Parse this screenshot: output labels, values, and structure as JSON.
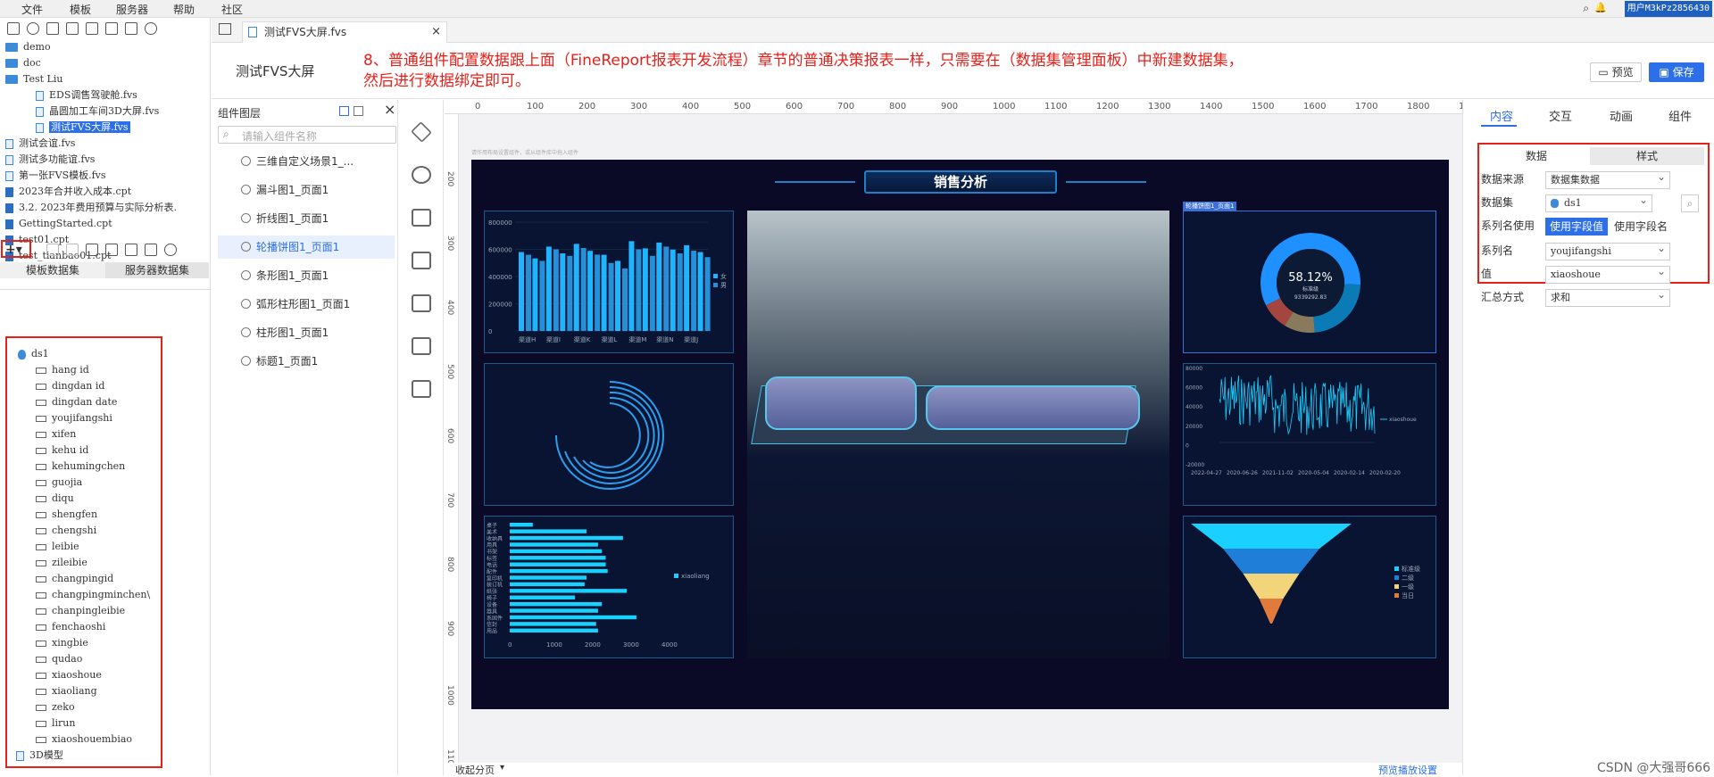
{
  "menu": {
    "items": [
      "文件",
      "模板",
      "服务器",
      "帮助",
      "社区"
    ],
    "user": "用户M3kPz2856430"
  },
  "left_tree": [
    {
      "label": "demo",
      "kind": "folder",
      "depth": 0
    },
    {
      "label": "doc",
      "kind": "folder",
      "depth": 0
    },
    {
      "label": "Test Liu",
      "kind": "folder",
      "depth": 0
    },
    {
      "label": "EDS调售驾驶舱.fvs",
      "kind": "file",
      "depth": 1
    },
    {
      "label": "晶圆加工车间3D大屏.fvs",
      "kind": "file",
      "depth": 1
    },
    {
      "label": "测试FVS大屏.fvs",
      "kind": "file",
      "depth": 1,
      "selected": true
    },
    {
      "label": "测试会谊.fvs",
      "kind": "file",
      "depth": 0
    },
    {
      "label": "测试多功能谊.fvs",
      "kind": "file",
      "depth": 0
    },
    {
      "label": "第一张FVS模板.fvs",
      "kind": "file",
      "depth": 0
    },
    {
      "label": "2023年合并收入成本.cpt",
      "kind": "cpt",
      "depth": 0
    },
    {
      "label": "3.2. 2023年费用预算与实际分析表.",
      "kind": "cpt",
      "depth": 0
    },
    {
      "label": "GettingStarted.cpt",
      "kind": "cpt",
      "depth": 0
    },
    {
      "label": "test01.cpt",
      "kind": "cpt",
      "depth": 0
    },
    {
      "label": "test_tianbao01.cpt",
      "kind": "cpt",
      "depth": 0
    }
  ],
  "dataset_tabs": {
    "template": "模板数据集",
    "server": "服务器数据集"
  },
  "dataset_name": "ds1",
  "fields": [
    "hang id",
    "dingdan id",
    "dingdan date",
    "youjifangshi",
    "xifen",
    "kehu id",
    "kehumingchen",
    "guojia",
    "diqu",
    "shengfen",
    "chengshi",
    "leibie",
    "zileibie",
    "changpingid",
    "changpingminchen\\",
    "chanpingleibie",
    "fenchaoshi",
    "xingbie",
    "qudao",
    "xiaoshoue",
    "xiaoliang",
    "zeko",
    "lirun",
    "xiaoshouembiao"
  ],
  "tree_bottom": "3D模型",
  "doc_tab": "测试FVS大屏.fvs",
  "header": {
    "title": "测试FVS大屏",
    "note_line1": "8、普通组件配置数据跟上面（FineReport报表开发流程）章节的普通决策报表一样，只需要在（数据集管理面板）中新建数据集，",
    "note_line2": "然后进行数据绑定即可。",
    "preview": "预览",
    "save": "保存"
  },
  "layers": {
    "title": "组件图层",
    "search_placeholder": "请输入组件名称",
    "items": [
      "三维自定义场景1_...",
      "漏斗图1_页面1",
      "折线图1_页面1",
      "轮播饼图1_页面1",
      "条形图1_页面1",
      "弧形柱形图1_页面1",
      "柱形图1_页面1",
      "标题1_页面1"
    ],
    "selected_index": 3
  },
  "ruler": {
    "h": [
      "0",
      "100",
      "200",
      "300",
      "400",
      "500",
      "600",
      "700",
      "800",
      "900",
      "1000",
      "1100",
      "1200",
      "1300",
      "1400",
      "1500",
      "1600",
      "1700",
      "1800",
      "1900"
    ],
    "v": [
      "200",
      "300",
      "400",
      "500",
      "600",
      "700",
      "800",
      "900",
      "1000",
      "1100"
    ]
  },
  "canvas_hint": "请作用布局设置组件，或从组件库中拖入组件",
  "dashboard": {
    "title": "销售分析",
    "selected_label": "轮播饼图1_页面1",
    "pie_pct": "58.12%",
    "pie_sub": "标准级",
    "pie_value": "9339292.83",
    "line_legend": "xiaoshoue",
    "hbar_legend": "xiaoliang",
    "bar_legend": [
      "女",
      "男"
    ],
    "funnel_legend": [
      "标准级",
      "二级",
      "一级",
      "当日"
    ]
  },
  "chart_data": [
    {
      "type": "bar",
      "title": "",
      "categories": [
        "渠道H",
        "渠道I",
        "渠道K",
        "渠道L",
        "渠道M",
        "渠道N",
        "渠道J"
      ],
      "series": [
        {
          "name": "女",
          "values": [
            580000,
            620000,
            640000,
            560000,
            660000,
            650000,
            630000
          ]
        },
        {
          "name": "男",
          "values": [
            560000,
            600000,
            610000,
            500000,
            600000,
            620000,
            590000
          ]
        }
      ],
      "yticks": [
        "0",
        "200000",
        "400000",
        "600000",
        "800000"
      ],
      "ylim": [
        0,
        800000
      ]
    },
    {
      "type": "pie",
      "title": "",
      "center_text": "58.12%",
      "center_sub": "标准级",
      "center_value": "9339292.83",
      "values": [
        58.12,
        23,
        10,
        8.88
      ]
    },
    {
      "type": "line",
      "title": "",
      "series": [
        {
          "name": "xiaoshoue"
        }
      ],
      "yticks": [
        "-20000",
        "0",
        "20000",
        "40000",
        "60000",
        "80000"
      ],
      "xticks": [
        "2022-04-27",
        "2020-06-26",
        "2021-11-02",
        "2020-05-04",
        "2020-02-14",
        "2020-02-20"
      ]
    },
    {
      "type": "bar",
      "orientation": "horizontal",
      "title": "",
      "categories": [
        "桌子",
        "美术",
        "收纳具",
        "用具",
        "书架",
        "标签",
        "电话",
        "配件",
        "复印机",
        "装订机",
        "纸张",
        "椅子",
        "设备",
        "器具",
        "系固件",
        "信封",
        "用品"
      ],
      "values": [
        600,
        2000,
        2950,
        2300,
        2400,
        2500,
        2500,
        2550,
        2000,
        1950,
        3050,
        1700,
        2400,
        2300,
        3300,
        2250,
        2300
      ],
      "series": [
        {
          "name": "xiaoliang"
        }
      ],
      "xticks": [
        "0",
        "1000",
        "2000",
        "3000",
        "4000"
      ]
    },
    {
      "type": "funnel",
      "title": "",
      "categories": [
        "标准级",
        "二级",
        "一级",
        "当日"
      ],
      "values": [
        100,
        60,
        35,
        15
      ]
    }
  ],
  "right": {
    "tabs": [
      "内容",
      "交互",
      "动画",
      "组件"
    ],
    "subtabs": [
      "数据",
      "样式"
    ],
    "rows": [
      {
        "label": "数据来源",
        "value": "数据集数据"
      },
      {
        "label": "数据集",
        "value": "ds1"
      },
      {
        "label": "系列名使用",
        "opt1": "使用字段值",
        "opt2": "使用字段名"
      },
      {
        "label": "系列名",
        "value": "youjifangshi"
      },
      {
        "label": "值",
        "value": "xiaoshoue"
      },
      {
        "label": "汇总方式",
        "value": "求和"
      }
    ]
  },
  "footer": {
    "collapse": "收起分页",
    "playback": "预览播放设置",
    "watermark": "CSDN @大强哥666"
  },
  "colors": {
    "accent": "#2c6fe8",
    "red": "#e8201a",
    "stage": "#0a0a26",
    "cyan": "#19d0ff"
  }
}
